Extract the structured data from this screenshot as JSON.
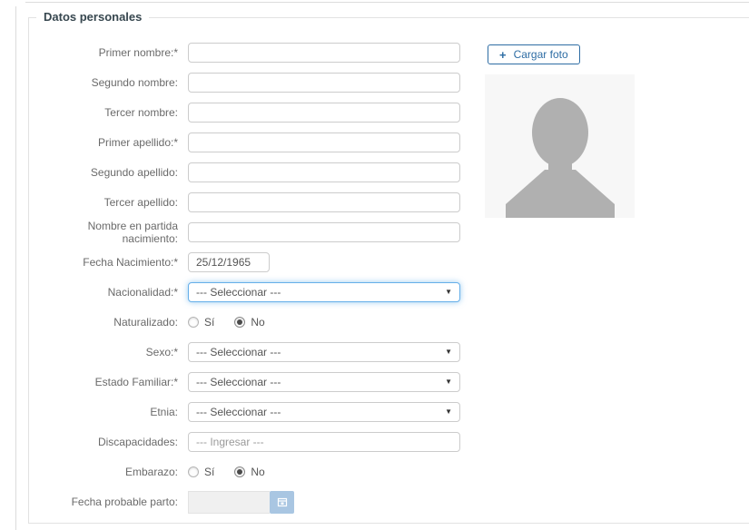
{
  "panel": {
    "legend": "Datos personales"
  },
  "photo": {
    "upload_button": "Cargar foto"
  },
  "icons": {
    "plus": "+",
    "dropdown_arrow": "▼"
  },
  "colors": {
    "accent_blue": "#2e6da4",
    "focus_border": "#66afe9",
    "calendar_button": "#a9c6e2",
    "silhouette_gray": "#b0b0b0",
    "photo_bg": "#f7f7f7",
    "legend_text": "#37474f"
  },
  "fields": {
    "primer_nombre": {
      "label": "Primer nombre:*",
      "value": ""
    },
    "segundo_nombre": {
      "label": "Segundo nombre:",
      "value": ""
    },
    "tercer_nombre": {
      "label": "Tercer nombre:",
      "value": ""
    },
    "primer_apellido": {
      "label": "Primer apellido:*",
      "value": ""
    },
    "segundo_apellido": {
      "label": "Segundo apellido:",
      "value": ""
    },
    "tercer_apellido": {
      "label": "Tercer apellido:",
      "value": ""
    },
    "nombre_partida": {
      "label": "Nombre en partida nacimiento:",
      "value": ""
    },
    "fecha_nacimiento": {
      "label": "Fecha Nacimiento:*",
      "value": "25/12/1965"
    },
    "nacionalidad": {
      "label": "Nacionalidad:*",
      "value": "--- Seleccionar ---"
    },
    "naturalizado": {
      "label": "Naturalizado:",
      "options": {
        "yes": "Sí",
        "no": "No"
      },
      "selected": "No"
    },
    "sexo": {
      "label": "Sexo:*",
      "value": "--- Seleccionar ---"
    },
    "estado_familiar": {
      "label": "Estado Familiar:*",
      "value": "--- Seleccionar ---"
    },
    "etnia": {
      "label": "Etnia:",
      "value": "--- Seleccionar ---"
    },
    "discapacidades": {
      "label": "Discapacidades:",
      "placeholder": "--- Ingresar ---"
    },
    "embarazo": {
      "label": "Embarazo:",
      "options": {
        "yes": "Sí",
        "no": "No"
      },
      "selected": "No"
    },
    "fecha_probable_parto": {
      "label": "Fecha probable parto:",
      "value": ""
    }
  }
}
